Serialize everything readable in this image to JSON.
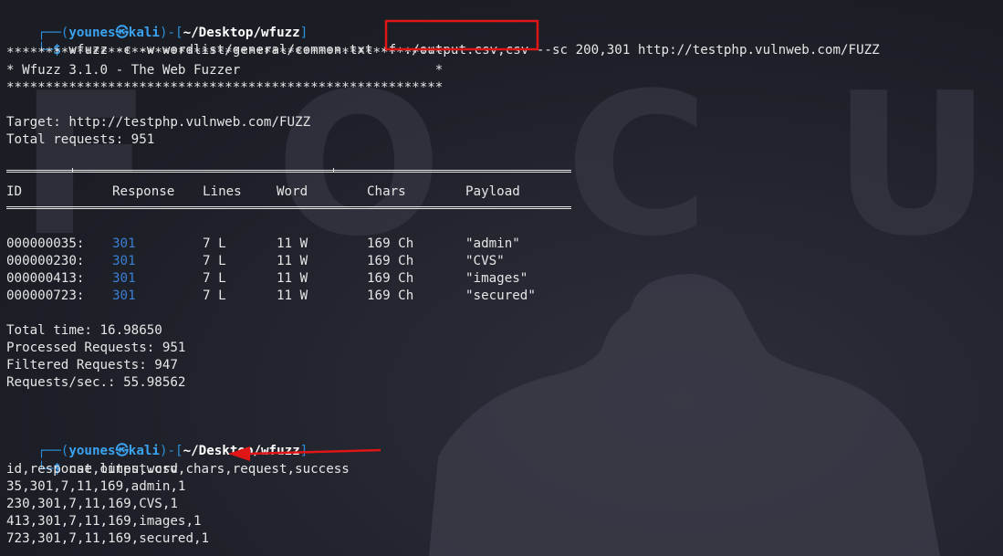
{
  "prompt": {
    "corner_top": "┌──",
    "corner_bottom": "└─",
    "user": "younes",
    "at_symbol": "㉿",
    "host": "kali",
    "path": "~/Desktop/wfuzz",
    "dollar": "$"
  },
  "background": {
    "text_letters": "F O C U"
  },
  "command1": {
    "program": "wfuzz",
    "args_before": " -c -w wordlist/general/common.txt -f ",
    "highlighted_arg": "./output.csv,csv",
    "args_after": " --sc 200,301 http://testphp.vulnweb.com/FUZZ"
  },
  "banner": {
    "stars": "********************************************************",
    "title_line": "* Wfuzz 3.1.0 - The Web Fuzzer                         *"
  },
  "target_line": "Target: http://testphp.vulnweb.com/FUZZ",
  "total_requests_line": "Total requests: 951",
  "table": {
    "headers": [
      "ID",
      "Response",
      "Lines",
      "Word",
      "Chars",
      "Payload"
    ],
    "rows": [
      {
        "id": "000000035:",
        "response": "301",
        "lines": "7 L",
        "word": "11 W",
        "chars": "169 Ch",
        "payload": "\"admin\""
      },
      {
        "id": "000000230:",
        "response": "301",
        "lines": "7 L",
        "word": "11 W",
        "chars": "169 Ch",
        "payload": "\"CVS\""
      },
      {
        "id": "000000413:",
        "response": "301",
        "lines": "7 L",
        "word": "11 W",
        "chars": "169 Ch",
        "payload": "\"images\""
      },
      {
        "id": "000000723:",
        "response": "301",
        "lines": "7 L",
        "word": "11 W",
        "chars": "169 Ch",
        "payload": "\"secured\""
      }
    ]
  },
  "stats": [
    "Total time: 16.98650",
    "Processed Requests: 951",
    "Filtered Requests: 947",
    "Requests/sec.: 55.98562"
  ],
  "command2": {
    "program": "cat",
    "args": " output.csv"
  },
  "csv_output": [
    "id,response,lines,word,chars,request,success",
    "35,301,7,11,169,admin,1",
    "230,301,7,11,169,CVS,1",
    "413,301,7,11,169,images,1",
    "723,301,7,11,169,secured,1"
  ],
  "colors": {
    "prompt_frame": "#2e8fd8",
    "prompt_user": "#3aa2ef",
    "path": "#ffffff",
    "response_code": "#3a7fd3",
    "highlight_box": "#e01515",
    "arrow": "#e01515"
  }
}
